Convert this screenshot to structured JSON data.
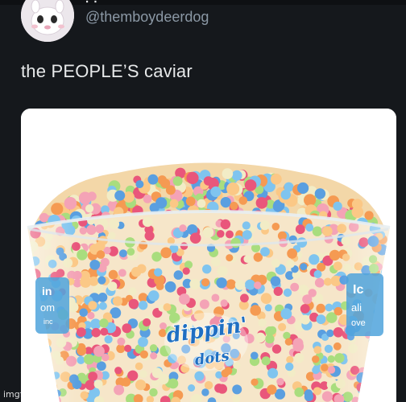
{
  "tweet": {
    "display_name": "∙ ∙",
    "handle": "@themboydeerdog",
    "text": "the PEOPLE’S caviar"
  },
  "media": {
    "cup_label_left": [
      "in",
      "om",
      "inc"
    ],
    "cup_label_right": [
      "Ic",
      "ali",
      "ove"
    ],
    "logo_word_1": "dippin'",
    "logo_word_2": "dots"
  },
  "watermark": "imgflip.com",
  "colors": {
    "background": "#15181c",
    "text": "#e7e9ea",
    "handle": "#8b98a5",
    "dots": [
      "#f4a3b6",
      "#a9dd7e",
      "#7fc4ef",
      "#f59a52",
      "#f2ecc6",
      "#e9567b",
      "#5a9fe0",
      "#fbc886"
    ]
  }
}
